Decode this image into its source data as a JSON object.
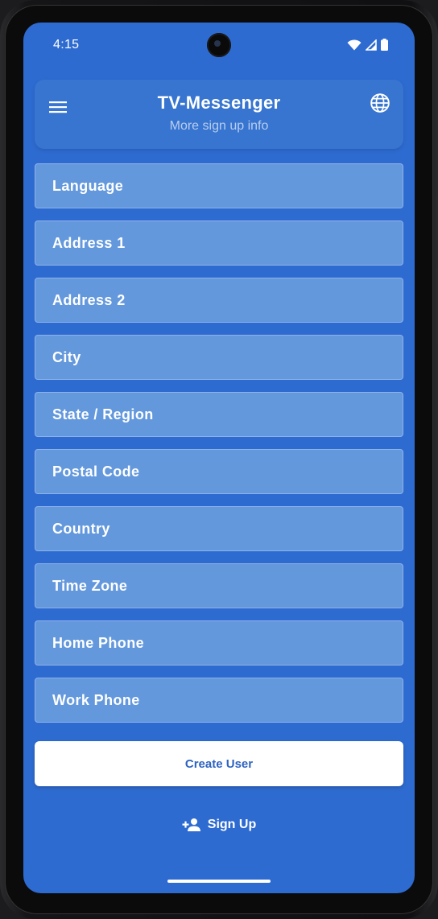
{
  "status_bar": {
    "time": "4:15"
  },
  "header": {
    "title": "TV-Messenger",
    "subtitle": "More sign up info",
    "menu_icon": "hamburger-menu-icon",
    "language_icon": "globe-icon"
  },
  "form": {
    "fields": [
      {
        "placeholder": "Language",
        "value": ""
      },
      {
        "placeholder": "Address 1",
        "value": ""
      },
      {
        "placeholder": "Address 2",
        "value": ""
      },
      {
        "placeholder": "City",
        "value": ""
      },
      {
        "placeholder": "State / Region",
        "value": ""
      },
      {
        "placeholder": "Postal Code",
        "value": ""
      },
      {
        "placeholder": "Country",
        "value": ""
      },
      {
        "placeholder": "Time Zone",
        "value": ""
      },
      {
        "placeholder": "Home Phone",
        "value": ""
      },
      {
        "placeholder": "Work Phone",
        "value": ""
      }
    ],
    "create_button_label": "Create User"
  },
  "footer": {
    "signup_label": "Sign Up",
    "signup_icon": "person-add-icon"
  },
  "colors": {
    "background": "#2e6bd0",
    "header": "#3775d0",
    "field_fill": "#6398dd",
    "button_text": "#2e63c0"
  }
}
